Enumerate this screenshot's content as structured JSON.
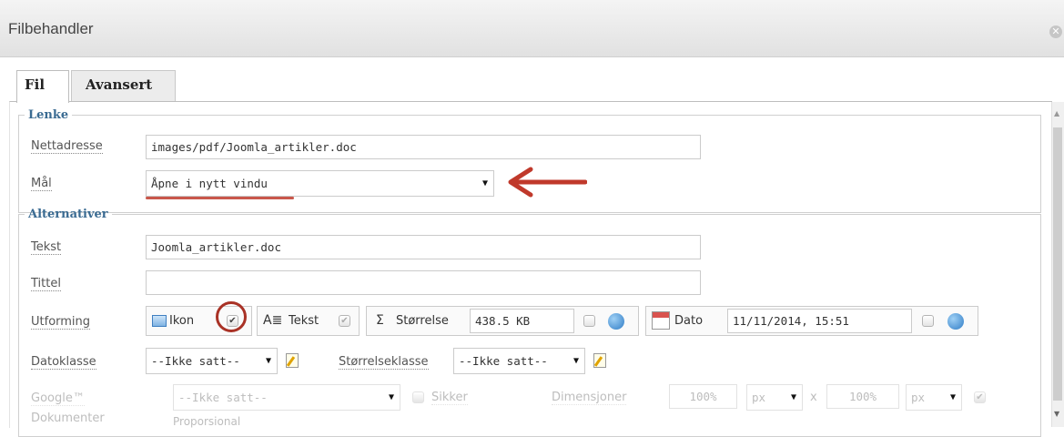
{
  "window": {
    "title": "Filbehandler",
    "close_icon": "close-icon"
  },
  "tabs": [
    {
      "label": "Fil",
      "active": true
    },
    {
      "label": "Avansert",
      "active": false
    }
  ],
  "lenke": {
    "legend": "Lenke",
    "url_label": "Nettadresse",
    "url_value": "images/pdf/Joomla_artikler.doc",
    "target_label": "Mål",
    "target_value": "Åpne i nytt vindu"
  },
  "alternativer": {
    "legend": "Alternativer",
    "text_label": "Tekst",
    "text_value": "Joomla_artikler.doc",
    "title_label": "Tittel",
    "title_value": "",
    "layout_label": "Utforming",
    "ikon_label": "Ikon",
    "ikon_checked": true,
    "tekst_label": "Tekst",
    "tekst_checked": true,
    "size_symbol": "Σ",
    "size_label": "Størrelse",
    "size_value": "438.5 KB",
    "date_label": "Dato",
    "date_value": "11/11/2014, 15:51",
    "dateclass_label": "Datoklasse",
    "dateclass_value": "--Ikke satt--",
    "sizeclass_label": "Størrelseklasse",
    "sizeclass_value": "--Ikke satt--",
    "google_label_1": "Google™",
    "google_label_2": "Dokumenter",
    "google_value": "--Ikke satt--",
    "secure_label": "Sikker",
    "dimensions_label": "Dimensjoner",
    "width_value": "100%",
    "width_unit": "px",
    "times": "x",
    "height_value": "100%",
    "height_unit": "px",
    "proportional_label": "Proporsional"
  },
  "annotation_color": "#c0392b"
}
